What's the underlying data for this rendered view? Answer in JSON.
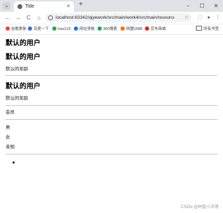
{
  "browser": {
    "tab_title": "Title",
    "tab_menu": "⌄",
    "tab_close": "✕",
    "new_tab": "+",
    "window_controls": {
      "minimize": "−",
      "maximize": "☐",
      "close": "✕"
    },
    "nav": {
      "back": "←",
      "forward": "→",
      "reload": "C",
      "home": "⌂"
    },
    "url": "localhost:63342/qiyework/src/main/work4/src/main/resources/templat...",
    "bookmarks": [
      {
        "label": "谷歌更新",
        "color": "#ea4335"
      },
      {
        "label": "百度一下",
        "color": "#3b6fe0"
      },
      {
        "label": "hao123",
        "color": "#2aa44f"
      },
      {
        "label": "网址导航",
        "color": "#1a73e8"
      },
      {
        "label": "360搜索",
        "color": "#22a35a"
      },
      {
        "label": "网盟1688",
        "color": "#ff6a00"
      },
      {
        "label": "京东商城",
        "color": "#e1251b"
      }
    ],
    "bookmarks_folder": "所有书签"
  },
  "page": {
    "heading1": "默认的用户",
    "heading2": "默认的用户",
    "text1": "默认的年龄",
    "heading3": "默认的用户",
    "text2": "默认的年龄",
    "text3": "会员",
    "gender_options": [
      "男",
      "女",
      "未知"
    ]
  },
  "watermark": "CSDN @码智小洋哥"
}
